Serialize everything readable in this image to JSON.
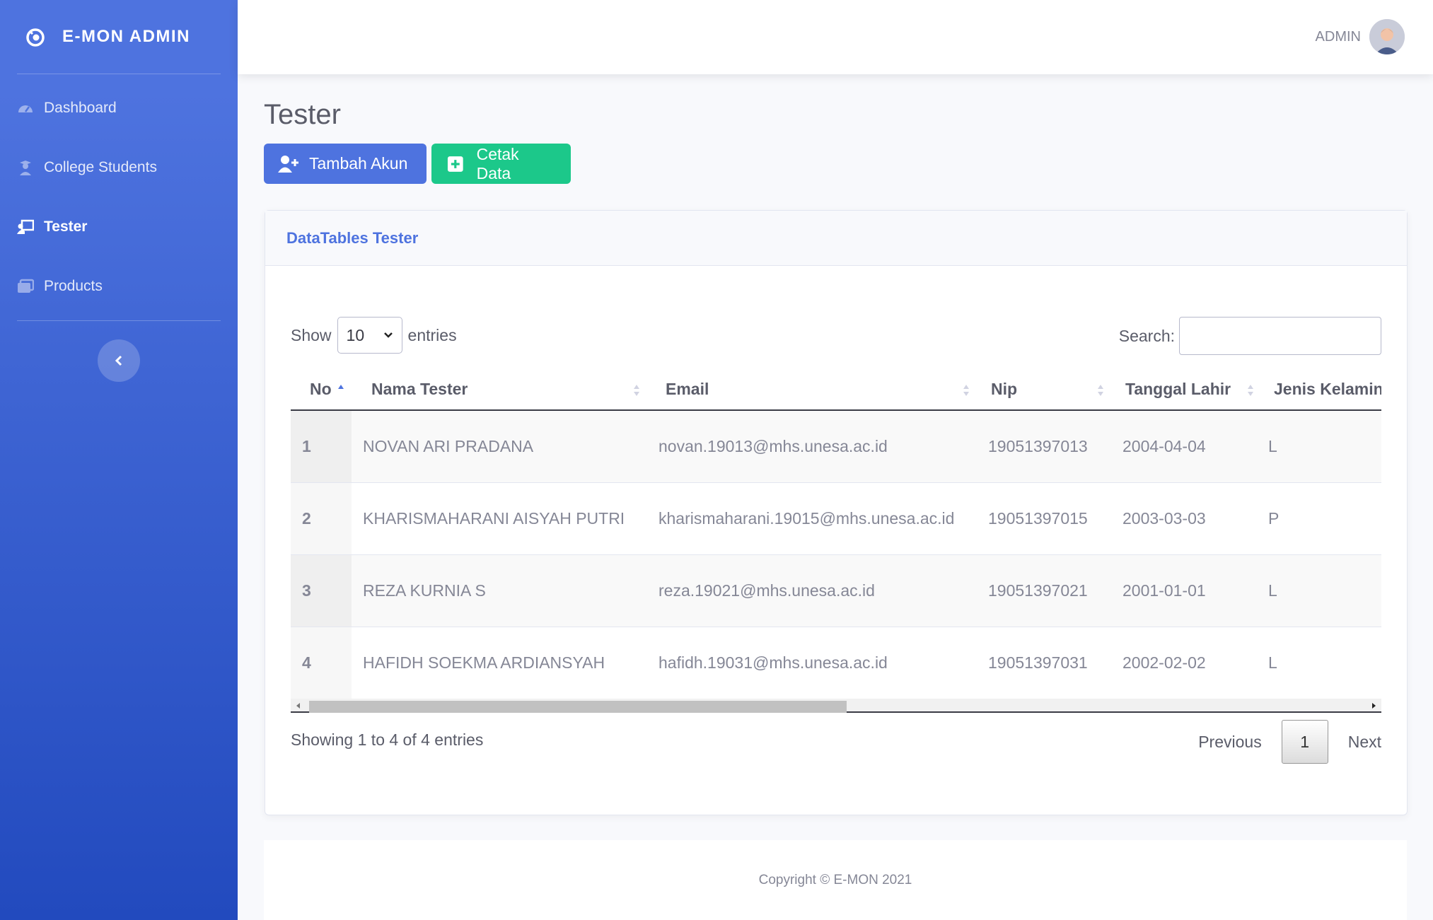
{
  "brand": {
    "title": "E-MON ADMIN"
  },
  "sidebar": {
    "items": [
      {
        "label": "Dashboard",
        "icon": "tachometer-icon",
        "active": false
      },
      {
        "label": "College Students",
        "icon": "user-graduate-icon",
        "active": false
      },
      {
        "label": "Tester",
        "icon": "chalkboard-teacher-icon",
        "active": true
      },
      {
        "label": "Products",
        "icon": "images-icon",
        "active": false
      }
    ]
  },
  "topbar": {
    "username": "ADMIN"
  },
  "page": {
    "title": "Tester"
  },
  "actions": {
    "add_label": "Tambah Akun",
    "print_label": "Cetak Data"
  },
  "card": {
    "title": "DataTables Tester"
  },
  "datatable": {
    "show_label": "Show",
    "entries_value": "10",
    "entries_label": "entries",
    "search_label": "Search:",
    "search_value": "",
    "columns": [
      "No",
      "Nama Tester",
      "Email",
      "Nip",
      "Tanggal Lahir",
      "Jenis Kelamin"
    ],
    "rows": [
      [
        "1",
        "NOVAN ARI PRADANA",
        "novan.19013@mhs.unesa.ac.id",
        "19051397013",
        "2004-04-04",
        "L"
      ],
      [
        "2",
        "KHARISMAHARANI AISYAH PUTRI",
        "kharismaharani.19015@mhs.unesa.ac.id",
        "19051397015",
        "2003-03-03",
        "P"
      ],
      [
        "3",
        "REZA KURNIA S",
        "reza.19021@mhs.unesa.ac.id",
        "19051397021",
        "2001-01-01",
        "L"
      ],
      [
        "4",
        "HAFIDH SOEKMA ARDIANSYAH",
        "hafidh.19031@mhs.unesa.ac.id",
        "19051397031",
        "2002-02-02",
        "L"
      ]
    ],
    "info": "Showing 1 to 4 of 4 entries",
    "previous_label": "Previous",
    "current_page": "1",
    "next_label": "Next"
  },
  "footer": {
    "copyright": "Copyright © E-MON 2021"
  },
  "colors": {
    "primary": "#4e73df",
    "success": "#1cc88a",
    "sidebar_end": "#224abe"
  }
}
